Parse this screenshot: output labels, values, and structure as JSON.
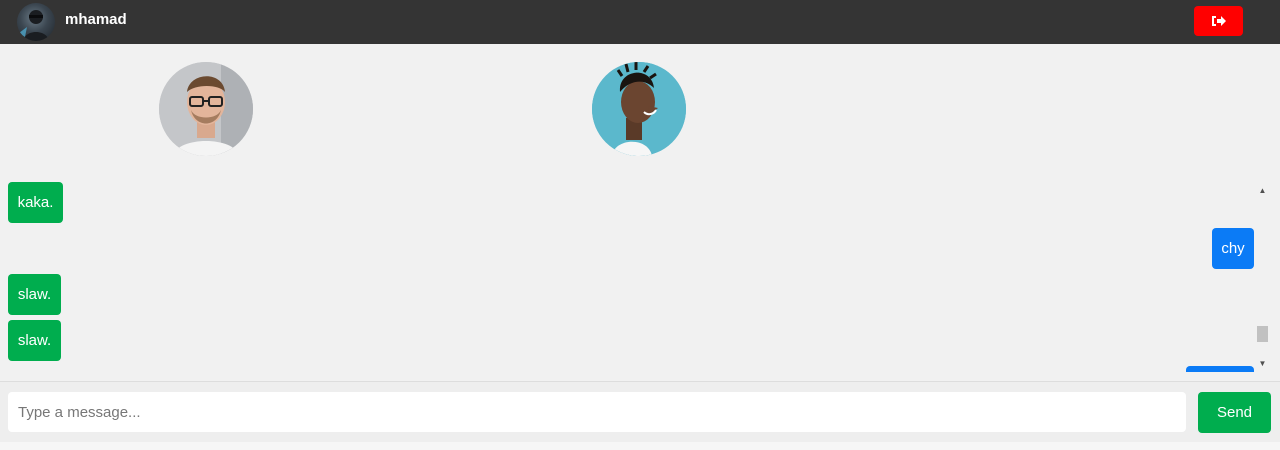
{
  "header": {
    "username": "mhamad",
    "avatar_icon": "user-avatar",
    "logout_icon": "sign-out-icon",
    "logout_color": "#ff0000"
  },
  "contacts": [
    {
      "avatar": "man-with-glasses-avatar"
    },
    {
      "avatar": "smiling-man-avatar"
    }
  ],
  "messages": [
    {
      "text": "kaka.",
      "direction": "incoming"
    },
    {
      "text": "chy",
      "direction": "outgoing"
    },
    {
      "text": "slaw.",
      "direction": "incoming"
    },
    {
      "text": "slaw.",
      "direction": "incoming"
    },
    {
      "text": "",
      "direction": "outgoing"
    }
  ],
  "composer": {
    "placeholder": "Type a message...",
    "value": "",
    "send_label": "Send"
  },
  "colors": {
    "incoming": "#00ad4e",
    "outgoing": "#0b7bf6",
    "topbar": "#343434"
  }
}
